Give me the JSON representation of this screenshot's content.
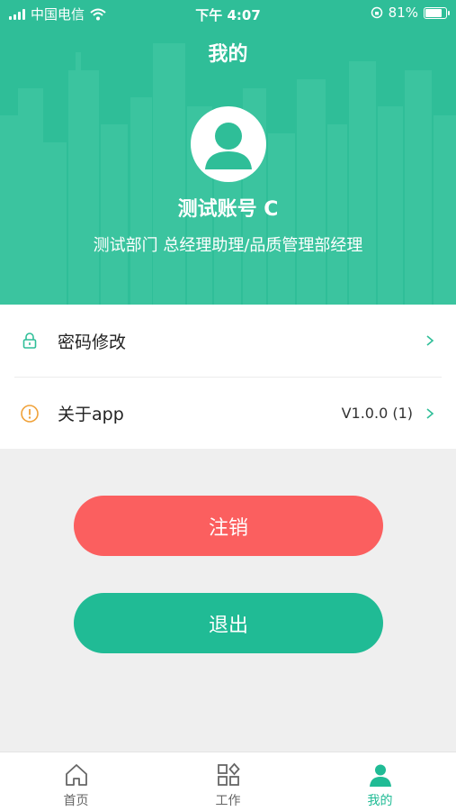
{
  "status_bar": {
    "carrier": "中国电信",
    "time": "下午 4:07",
    "battery": "81%"
  },
  "header": {
    "title": "我的",
    "user_name": "测试账号 C",
    "user_dept": "测试部门 总经理助理/品质管理部经理"
  },
  "menu": {
    "items": [
      {
        "icon": "lock-icon",
        "label": "密码修改",
        "value": ""
      },
      {
        "icon": "info-icon",
        "label": "关于app",
        "value": "V1.0.0 (1)"
      }
    ]
  },
  "buttons": {
    "cancel_label": "注销",
    "logout_label": "退出"
  },
  "tabbar": {
    "items": [
      {
        "icon": "home-icon",
        "label": "首页",
        "active": false
      },
      {
        "icon": "grid-icon",
        "label": "工作",
        "active": false
      },
      {
        "icon": "person-icon",
        "label": "我的",
        "active": true
      }
    ]
  },
  "colors": {
    "primary": "#2fbe98",
    "danger": "#fb5f5f",
    "button_green": "#20bb95",
    "background": "#efefef"
  }
}
